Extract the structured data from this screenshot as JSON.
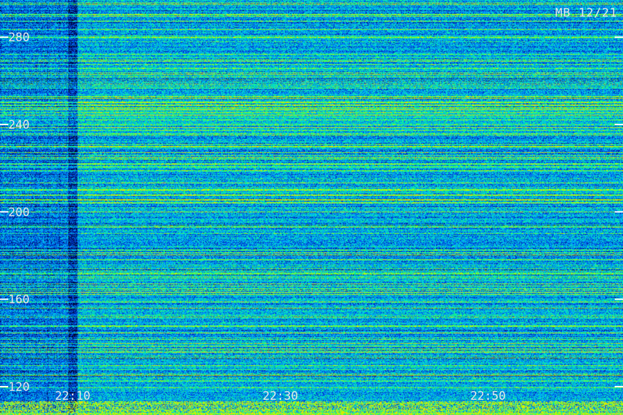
{
  "chart_data": {
    "type": "heatmap",
    "title": "",
    "corner_label": "MB 12/21",
    "xlabel": "",
    "ylabel": "",
    "x_tick_labels": [
      "22:10",
      "22:30",
      "22:50"
    ],
    "y_tick_labels": [
      "280",
      "240",
      "200",
      "160",
      "120"
    ],
    "y_ticks": [
      280,
      240,
      200,
      160,
      120
    ],
    "ylim": [
      107,
      297
    ],
    "x_time_range": [
      "22:03",
      "23:03"
    ],
    "grid": false,
    "colormap": [
      "#000010",
      "#001a80",
      "#0040e0",
      "#00a0ff",
      "#00e0d0",
      "#20ff60",
      "#c0ff00",
      "#ffd000"
    ]
  }
}
